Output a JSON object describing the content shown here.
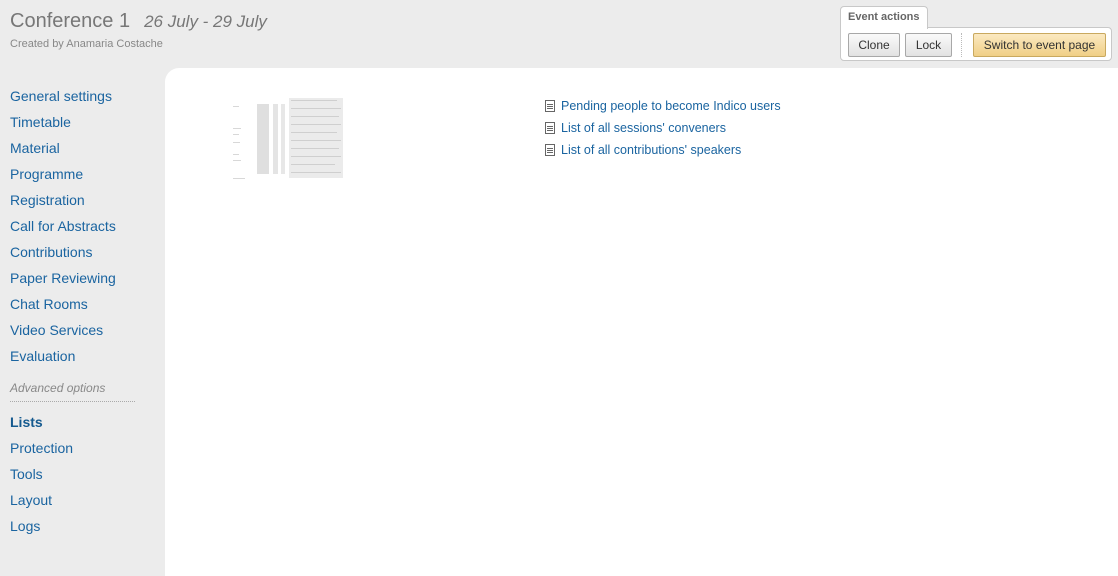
{
  "header": {
    "title": "Conference 1",
    "dates": "26 July - 29 July",
    "created_by": "Created by Anamaria Costache"
  },
  "event_actions": {
    "label": "Event actions",
    "clone": "Clone",
    "lock": "Lock",
    "switch": "Switch to event page"
  },
  "sidebar": {
    "items": [
      {
        "label": "General settings"
      },
      {
        "label": "Timetable"
      },
      {
        "label": "Material"
      },
      {
        "label": "Programme"
      },
      {
        "label": "Registration"
      },
      {
        "label": "Call for Abstracts"
      },
      {
        "label": "Contributions"
      },
      {
        "label": "Paper Reviewing"
      },
      {
        "label": "Chat Rooms"
      },
      {
        "label": "Video Services"
      },
      {
        "label": "Evaluation"
      }
    ],
    "advanced_label": "Advanced options",
    "advanced_items": [
      {
        "label": "Lists",
        "active": true
      },
      {
        "label": "Protection"
      },
      {
        "label": "Tools"
      },
      {
        "label": "Layout"
      },
      {
        "label": "Logs"
      }
    ]
  },
  "lists": [
    {
      "label": "Pending people to become Indico users",
      "icon": "document-icon"
    },
    {
      "label": "List of all sessions' conveners",
      "icon": "document-icon"
    },
    {
      "label": "List of all contributions' speakers",
      "icon": "document-icon"
    }
  ],
  "colors": {
    "link": "#1a64a0",
    "switch_button": "#f0cf86"
  }
}
